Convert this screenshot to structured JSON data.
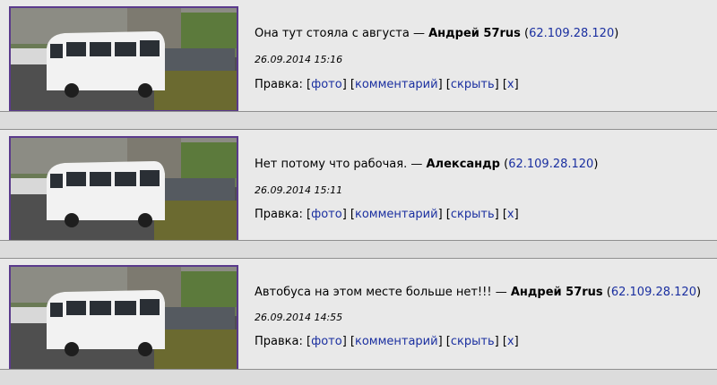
{
  "comments": [
    {
      "text": "Она тут стояла с августа",
      "dash": " — ",
      "author": "Андрей 57rus",
      "ip": "62.109.28.120",
      "date": "26.09.2014 15:16",
      "actions_label": "Правка:",
      "photo_link": "фото",
      "comment_link": "комментарий",
      "hide_link": "скрыть",
      "delete_link": "x"
    },
    {
      "text": "Нет потому что рабочая.",
      "dash": " — ",
      "author": "Александр",
      "ip": "62.109.28.120",
      "date": "26.09.2014 15:11",
      "actions_label": "Правка:",
      "photo_link": "фото",
      "comment_link": "комментарий",
      "hide_link": "скрыть",
      "delete_link": "x"
    },
    {
      "text": "Автобуса на этом месте больше нет!!!",
      "dash": " — ",
      "author": "Андрей 57rus",
      "ip": "62.109.28.120",
      "date": "26.09.2014 14:55",
      "actions_label": "Правка:",
      "photo_link": "фото",
      "comment_link": "комментарий",
      "hide_link": "скрыть",
      "delete_link": "x"
    }
  ],
  "colors": {
    "link": "#1a2fa0",
    "thumb_border": "#5a3a8c",
    "background": "#e9e9e9",
    "separator": "#8f8f8f"
  }
}
